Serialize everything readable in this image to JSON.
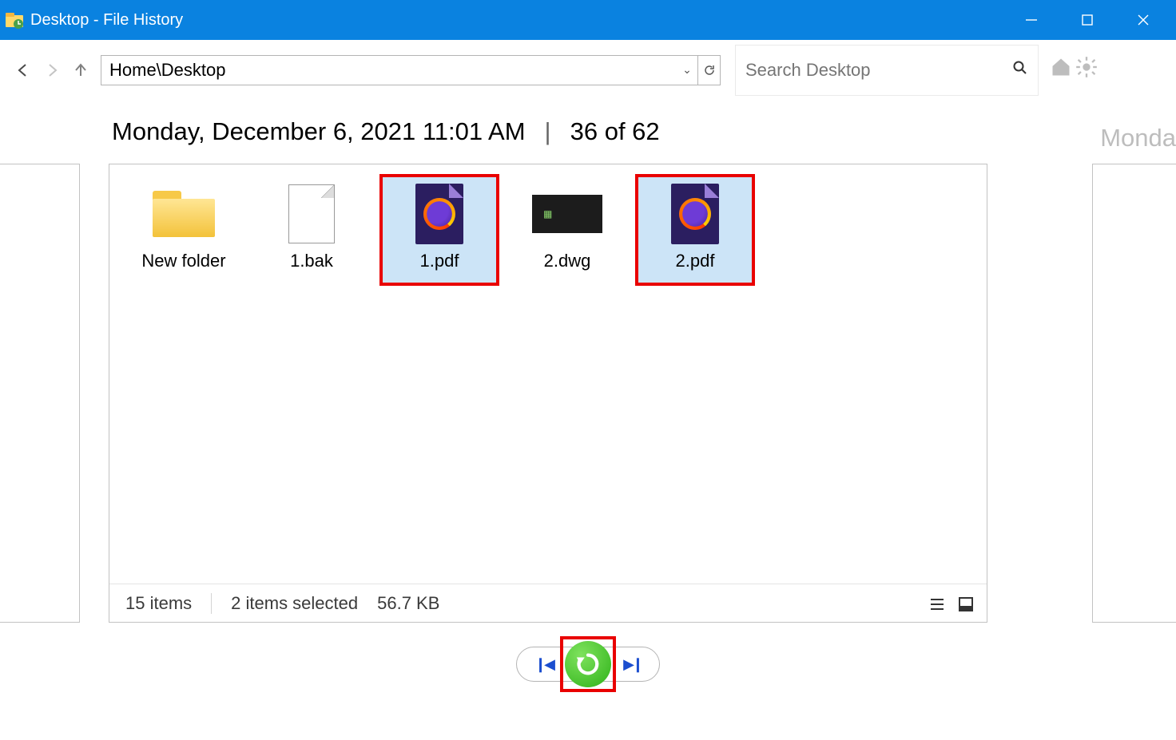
{
  "window": {
    "title": "Desktop - File History"
  },
  "nav": {
    "path": "Home\\Desktop",
    "search_placeholder": "Search Desktop"
  },
  "header": {
    "timestamp": "Monday, December 6, 2021 11:01 AM",
    "pager": "36 of 62",
    "peek_right": "Monda"
  },
  "files": [
    {
      "name": "New folder",
      "type": "folder",
      "selected": false,
      "highlighted": false
    },
    {
      "name": "1.bak",
      "type": "blank",
      "selected": false,
      "highlighted": false
    },
    {
      "name": "1.pdf",
      "type": "pdf",
      "selected": true,
      "highlighted": true
    },
    {
      "name": "2.dwg",
      "type": "dwg",
      "selected": false,
      "highlighted": false
    },
    {
      "name": "2.pdf",
      "type": "pdf",
      "selected": true,
      "highlighted": true
    }
  ],
  "status": {
    "item_count": "15 items",
    "selection": "2 items selected",
    "size": "56.7 KB"
  }
}
